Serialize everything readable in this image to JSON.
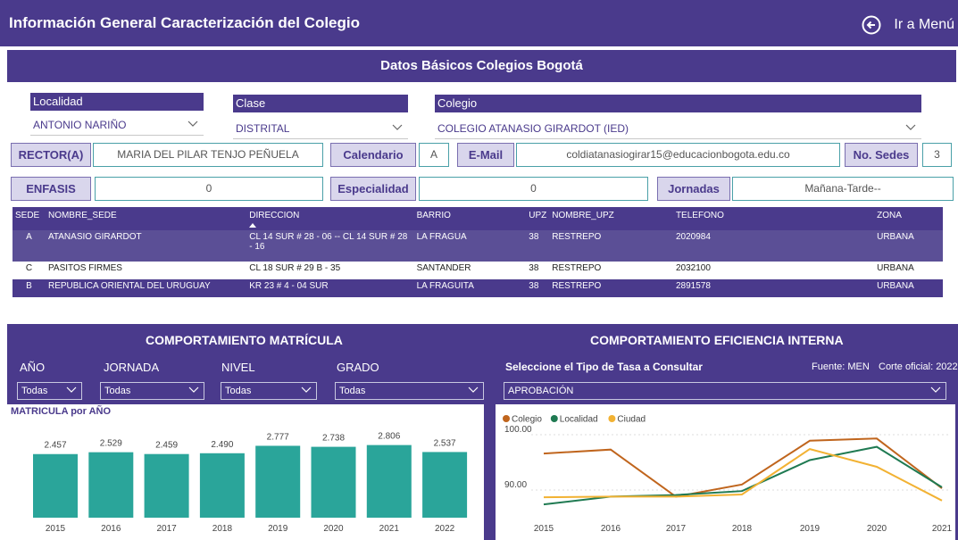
{
  "topbar": {
    "title": "Información General Caracterización del Colegio",
    "menu_label": "Ir a Menú"
  },
  "section": {
    "title": "Datos Básicos Colegios Bogotá"
  },
  "filters": {
    "localidad": {
      "label": "Localidad",
      "value": "ANTONIO NARIÑO"
    },
    "clase": {
      "label": "Clase",
      "value": "DISTRITAL"
    },
    "colegio": {
      "label": "Colegio",
      "value": "COLEGIO ATANASIO GIRARDOT (IED)"
    }
  },
  "info": {
    "rector_label": "RECTOR(A)",
    "rector_value": "MARIA DEL PILAR TENJO PEÑUELA",
    "calendario_label": "Calendario",
    "calendario_value": "A",
    "email_label": "E-Mail",
    "email_value": "coldiatanasiogirar15@educacionbogota.edu.co",
    "sedes_label": "No. Sedes",
    "sedes_value": "3",
    "enfasis_label": "ENFASIS",
    "enfasis_value": "0",
    "especialidad_label": "Especialidad",
    "especialidad_value": "0",
    "jornadas_label": "Jornadas",
    "jornadas_value": "Mañana-Tarde--"
  },
  "table": {
    "headers": [
      "SEDE",
      "NOMBRE_SEDE",
      "DIRECCION",
      "BARRIO",
      "UPZ",
      "NOMBRE_UPZ",
      "TELEFONO",
      "ZONA"
    ],
    "rows": [
      [
        "A",
        "ATANASIO GIRARDOT",
        "CL 14 SUR # 28 - 06 -- CL 14 SUR # 28 - 16",
        "LA FRAGUA",
        "38",
        "RESTREPO",
        "2020984",
        "URBANA"
      ],
      [
        "C",
        "PASITOS FIRMES",
        "CL 18 SUR # 29 B - 35",
        "SANTANDER",
        "38",
        "RESTREPO",
        "2032100",
        "URBANA"
      ],
      [
        "B",
        "REPUBLICA ORIENTAL DEL URUGUAY",
        "KR 23 # 4 - 04 SUR",
        "LA FRAGUITA",
        "38",
        "RESTREPO",
        "2891578",
        "URBANA"
      ]
    ]
  },
  "matricula": {
    "title": "COMPORTAMIENTO MATRÍCULA",
    "slicers": [
      {
        "label": "AÑO",
        "value": "Todas"
      },
      {
        "label": "JORNADA",
        "value": "Todas"
      },
      {
        "label": "NIVEL",
        "value": "Todas"
      },
      {
        "label": "GRADO",
        "value": "Todas"
      }
    ],
    "chart_title": "MATRICULA por AÑO"
  },
  "eficiencia": {
    "title": "COMPORTAMIENTO EFICIENCIA INTERNA",
    "select_label": "Seleccione el Tipo de Tasa a Consultar",
    "fuente": "Fuente: MEN",
    "corte": "Corte oficial: 2022",
    "select_value": "APROBACIÓN"
  },
  "colors": {
    "brand": "#4a3a8c",
    "bar": "#2aa59a",
    "colegio": "#c0651d",
    "localidad": "#1f7a52",
    "ciudad": "#f2b233"
  },
  "chart_data": [
    {
      "type": "bar",
      "title": "MATRICULA por AÑO",
      "categories": [
        "2015",
        "2016",
        "2017",
        "2018",
        "2019",
        "2020",
        "2021",
        "2022"
      ],
      "values": [
        2457,
        2529,
        2459,
        2490,
        2777,
        2738,
        2806,
        2537
      ],
      "value_labels": [
        "2.457",
        "2.529",
        "2.459",
        "2.490",
        "2.777",
        "2.738",
        "2.806",
        "2.537"
      ]
    },
    {
      "type": "line",
      "categories": [
        "2015",
        "2016",
        "2017",
        "2018",
        "2019",
        "2020",
        "2021"
      ],
      "y_ticks": [
        "100.00",
        "90.00"
      ],
      "legend_position": "top-left",
      "series": [
        {
          "name": "Colegio",
          "values": [
            96.6,
            97.3,
            88.8,
            91.0,
            98.9,
            99.3,
            90.3
          ]
        },
        {
          "name": "Localidad",
          "values": [
            87.4,
            88.8,
            89.1,
            89.8,
            95.4,
            97.8,
            90.5
          ]
        },
        {
          "name": "Ciudad",
          "values": [
            88.7,
            88.8,
            88.8,
            89.2,
            97.4,
            94.2,
            88.1
          ]
        }
      ]
    }
  ]
}
